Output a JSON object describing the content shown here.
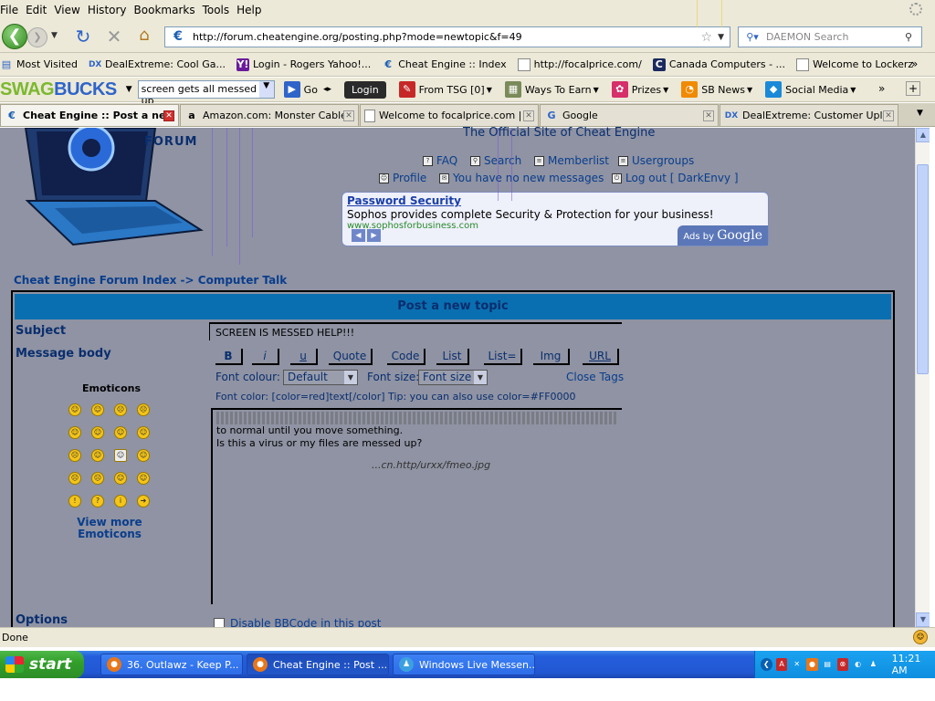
{
  "menu": [
    "File",
    "Edit",
    "View",
    "History",
    "Bookmarks",
    "Tools",
    "Help"
  ],
  "nav": {
    "url": "http://forum.cheatengine.org/posting.php?mode=newtopic&f=49",
    "search_placeholder": "DAEMON Search"
  },
  "bookmarks": [
    {
      "label": "Most Visited",
      "icon": "star-icon"
    },
    {
      "label": "DealExtreme: Cool Ga...",
      "icon": "dx-icon"
    },
    {
      "label": "Login - Rogers Yahoo!...",
      "icon": "yahoo-icon"
    },
    {
      "label": "Cheat Engine :: Index",
      "icon": "cheatengine-icon"
    },
    {
      "label": "http://focalprice.com/",
      "icon": "page-icon"
    },
    {
      "label": "Canada Computers - ...",
      "icon": "cc-icon"
    },
    {
      "label": "Welcome to Lockerz",
      "icon": "page-icon"
    }
  ],
  "swagbucks": {
    "logo_a": "SWAG",
    "logo_b": "BUCKS",
    "search_value": "screen gets all  messed up",
    "go": "Go",
    "login": "Login",
    "items": [
      "From TSG [0]",
      "Ways To Earn",
      "Prizes",
      "SB News",
      "Social Media"
    ]
  },
  "tabs": [
    {
      "label": "Cheat Engine :: Post a ne...",
      "icon": "cheatengine-icon",
      "active": true
    },
    {
      "label": "Amazon.com: Monster Cable...",
      "icon": "amazon-icon",
      "active": false
    },
    {
      "label": "Welcome to focalprice.com | ...",
      "icon": "page-icon",
      "active": false
    },
    {
      "label": "Google",
      "icon": "google-icon",
      "active": false
    },
    {
      "label": "DealExtreme: Customer Uplo...",
      "icon": "dx-icon",
      "active": false
    }
  ],
  "forum": {
    "forum_tag": "FORUM",
    "site_title": "The Official Site of Cheat Engine",
    "links_row1": [
      "FAQ",
      "Search",
      "Memberlist",
      "Usergroups"
    ],
    "links_row2": [
      "Profile",
      "You have no new messages",
      "Log out [ DarkEnvy ]"
    ],
    "ad": {
      "title": "Password Security",
      "desc": "Sophos provides complete Security & Protection for your business!",
      "url": "www.sophosforbusiness.com",
      "ads_by": "Ads by",
      "google": "Google"
    },
    "breadcrumb": "Cheat Engine Forum Index -> Computer Talk",
    "post_header": "Post a new topic",
    "subject_label": "Subject",
    "subject_value": "SCREEN IS MESSED HELP!!!",
    "message_label": "Message body",
    "bbcode_buttons": [
      "B",
      "i",
      "u",
      "Quote",
      "Code",
      "List",
      "List=",
      "Img",
      "URL"
    ],
    "font_colour_label": "Font colour:",
    "font_colour_value": "Default",
    "font_size_label": "Font size:",
    "font_size_value": "Font size",
    "close_tags": "Close Tags",
    "tip": "Font color: [color=red]text[/color]  Tip: you can also use color=#FF0000",
    "message_lines": [
      "to normal until you move something.",
      "Is this a virus or my files are messed up?",
      "...cn.http/urxx/fmeo.jpg"
    ],
    "emoticons_label": "Emoticons",
    "view_more": "View more Emoticons",
    "options_label": "Options",
    "disable_bbcode": "Disable BBCode in this post"
  },
  "status": "Done",
  "taskbar": {
    "start": "start",
    "items": [
      "36. Outlawz - Keep P...",
      "Cheat Engine :: Post ...",
      "Windows Live Messen..."
    ],
    "time": "11:21 AM"
  }
}
